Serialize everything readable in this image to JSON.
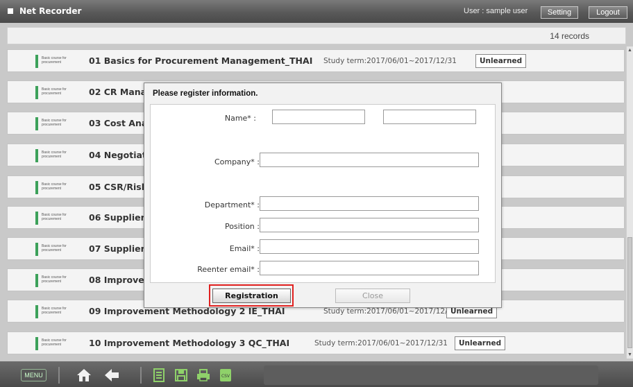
{
  "header": {
    "app_title": "Net Recorder",
    "user_text": "User : sample user",
    "setting_label": "Setting",
    "logout_label": "Logout"
  },
  "records": {
    "count_text": "14 records"
  },
  "courses": [
    {
      "category": "Basic course for procurement",
      "title": "01 Basics for Procurement Management_THAI",
      "term": "Study term:2017/06/01~2017/12/31",
      "status": "Unlearned"
    },
    {
      "category": "Basic course for procurement",
      "title": "02 CR Mana"
    },
    {
      "category": "Basic course for procurement",
      "title": "03 Cost Ana"
    },
    {
      "category": "Basic course for procurement",
      "title": "04 Negotiat"
    },
    {
      "category": "Basic course for procurement",
      "title": "05 CSR/Risl"
    },
    {
      "category": "Basic course for procurement",
      "title": "06 Supplier"
    },
    {
      "category": "Basic course for procurement",
      "title": "07 Supplier"
    },
    {
      "category": "Basic course for procurement",
      "title": "08 Improve"
    },
    {
      "category": "Basic course for procurement",
      "title": "09 Improvement Methodology 2 IE_THAI",
      "term": "Study term:2017/06/01~2017/12/31",
      "status": "Unlearned"
    },
    {
      "category": "Basic course for procurement",
      "title": "10 Improvement Methodology 3 QC_THAI",
      "term": "Study term:2017/06/01~2017/12/31",
      "status": "Unlearned"
    }
  ],
  "modal": {
    "title": "Please register information.",
    "name_label": "Name* :",
    "company_label": "Company* :",
    "department_label": "Department* :",
    "position_label": "Position :",
    "email_label": "Email* :",
    "reenter_email_label": "Reenter email* :",
    "registration_label": "Registration",
    "close_label": "Close"
  },
  "footer": {
    "menu_label": "MENU",
    "csv_label": "CSV"
  },
  "colors": {
    "accent_green": "#3da15a",
    "highlight_red": "#e0201f"
  },
  "icons": [
    "home-icon",
    "back-arrow-icon",
    "document-icon",
    "save-icon",
    "print-icon",
    "csv-icon"
  ]
}
